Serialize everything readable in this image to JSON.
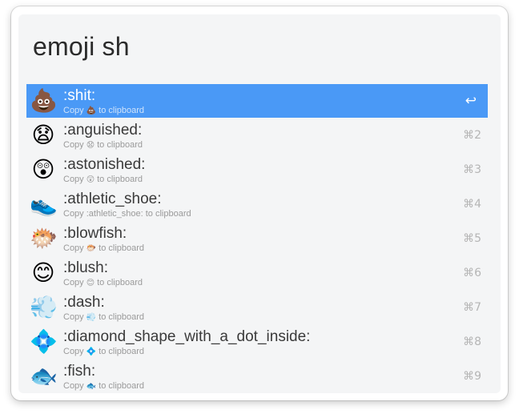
{
  "search": {
    "query": "emoji sh"
  },
  "results": [
    {
      "emoji": "💩",
      "icon": "pile-of-poo-icon",
      "title": ":shit:",
      "sub_prefix": "Copy",
      "sub_emoji": "💩",
      "sub_suffix": "to clipboard",
      "shortcut": "↩",
      "selected": true
    },
    {
      "emoji": "😧",
      "icon": "anguished-face-icon",
      "title": ":anguished:",
      "sub_prefix": "Copy",
      "sub_emoji": "😧",
      "sub_suffix": "to clipboard",
      "shortcut": "⌘2"
    },
    {
      "emoji": "😲",
      "icon": "astonished-face-icon",
      "title": ":astonished:",
      "sub_prefix": "Copy",
      "sub_emoji": "😲",
      "sub_suffix": "to clipboard",
      "shortcut": "⌘3"
    },
    {
      "emoji": "👟",
      "icon": "athletic-shoe-icon",
      "title": ":athletic_shoe:",
      "sub_prefix": "Copy :athletic_shoe: to clipboard",
      "sub_emoji": "",
      "sub_suffix": "",
      "shortcut": "⌘4"
    },
    {
      "emoji": "🐡",
      "icon": "blowfish-icon",
      "title": ":blowfish:",
      "sub_prefix": "Copy",
      "sub_emoji": "🐡",
      "sub_suffix": "to clipboard",
      "shortcut": "⌘5"
    },
    {
      "emoji": "😊",
      "icon": "blush-face-icon",
      "title": ":blush:",
      "sub_prefix": "Copy",
      "sub_emoji": "😊",
      "sub_suffix": "to clipboard",
      "shortcut": "⌘6"
    },
    {
      "emoji": "💨",
      "icon": "dash-icon",
      "title": ":dash:",
      "sub_prefix": "Copy",
      "sub_emoji": "💨",
      "sub_suffix": "to clipboard",
      "shortcut": "⌘7"
    },
    {
      "emoji": "💠",
      "icon": "diamond-shape-with-dot-icon",
      "title": ":diamond_shape_with_a_dot_inside:",
      "sub_prefix": "Copy",
      "sub_emoji": "💠",
      "sub_suffix": "to clipboard",
      "shortcut": "⌘8"
    },
    {
      "emoji": "🐟",
      "icon": "fish-icon",
      "title": ":fish:",
      "sub_prefix": "Copy",
      "sub_emoji": "🐟",
      "sub_suffix": "to clipboard",
      "shortcut": "⌘9"
    }
  ],
  "colors": {
    "selection": "#4a99f6",
    "panel": "#f4f5f6"
  }
}
